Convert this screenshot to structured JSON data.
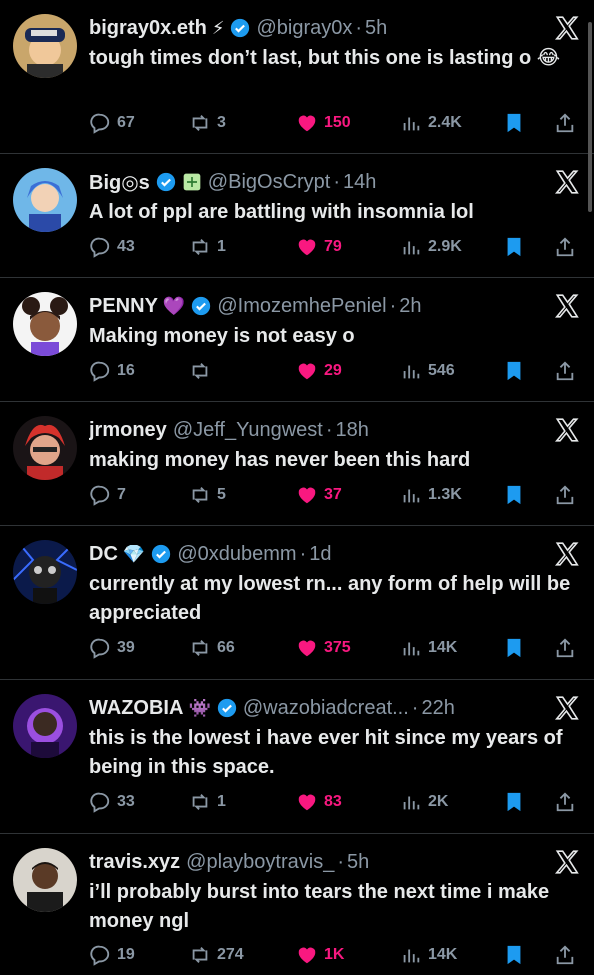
{
  "accent": "#1d9bf0",
  "like_color": "#f91880",
  "tweets": [
    {
      "name": "bigray0x.eth",
      "name_emoji": "⚡",
      "verified": true,
      "handle": "@bigray0x",
      "time": "5h",
      "text": "tough times don’t last, but this one is lasting o 😂",
      "reply_count": "67",
      "retweet_count": "3",
      "like_count": "150",
      "view_count": "2.4K",
      "avatar_icon": "cartoon-avatar-icon"
    },
    {
      "name": "Big◎s",
      "name_emoji": "",
      "verified": true,
      "handle": "@BigOsCrypt",
      "time": "14h",
      "text": "A lot of ppl are battling with insomnia lol",
      "reply_count": "43",
      "retweet_count": "1",
      "like_count": "79",
      "view_count": "2.9K",
      "avatar_icon": "anime-avatar-icon"
    },
    {
      "name": "PENNY",
      "name_emoji": "💜",
      "verified": true,
      "handle": "@ImozemhePeniel",
      "time": "2h",
      "text": "Making money is not easy o",
      "reply_count": "16",
      "retweet_count": "",
      "like_count": "29",
      "view_count": "546",
      "avatar_icon": "girl-avatar-icon"
    },
    {
      "name": "jrmoney",
      "name_emoji": "",
      "verified": false,
      "handle": "@Jeff_Yungwest",
      "time": "18h",
      "text": "making money has never been this hard",
      "reply_count": "7",
      "retweet_count": "5",
      "like_count": "37",
      "view_count": "1.3K",
      "avatar_icon": "red-hair-avatar-icon"
    },
    {
      "name": "DC",
      "name_emoji": "💎",
      "verified": true,
      "handle": "@0xdubemm",
      "time": "1d",
      "text": "currently at my lowest rn... any form of help will be appreciated",
      "reply_count": "39",
      "retweet_count": "66",
      "like_count": "375",
      "view_count": "14K",
      "avatar_icon": "mask-avatar-icon"
    },
    {
      "name": "WAZOBIA",
      "name_emoji": "👾",
      "verified": true,
      "handle": "@wazobiadcreat...",
      "time": "22h",
      "text": "this is the lowest i have ever hit since my years of being in this space.",
      "reply_count": "33",
      "retweet_count": "1",
      "like_count": "83",
      "view_count": "2K",
      "avatar_icon": "purple-avatar-icon"
    },
    {
      "name": "travis.xyz",
      "name_emoji": "",
      "verified": false,
      "handle": "@playboytravis_",
      "time": "5h",
      "text": "i’ll probably burst into tears the next time i make money ngl",
      "reply_count": "19",
      "retweet_count": "274",
      "like_count": "1K",
      "view_count": "14K",
      "avatar_icon": "photo-avatar-icon"
    }
  ]
}
